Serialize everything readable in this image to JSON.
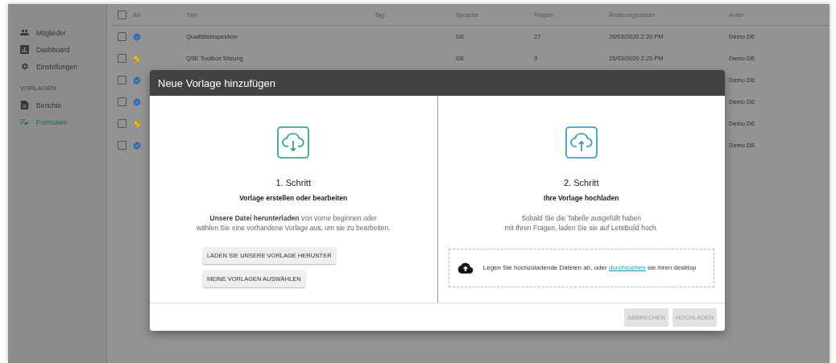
{
  "sidebar": {
    "items": [
      {
        "kind": "people",
        "label": "Mitglieder",
        "selected": false
      },
      {
        "kind": "chart",
        "label": "Dashboard",
        "selected": false
      },
      {
        "kind": "gear",
        "label": "Einstellungen",
        "selected": false
      }
    ],
    "section": {
      "title": "VORLAGEN",
      "items": [
        {
          "kind": "document",
          "label": "Berichte",
          "selected": false
        },
        {
          "kind": "checklist",
          "label": "Formulare",
          "selected": true
        }
      ]
    }
  },
  "table": {
    "select_all_checked": false,
    "columns": [
      "Art",
      "Titel",
      "Tag",
      "Sprache",
      "Fragen",
      "Änderungsdatum",
      "Autor"
    ],
    "rows": [
      {
        "checked": false,
        "kind": "verified",
        "title": "Qualitätsinspektion",
        "language": "DE",
        "questions": "27",
        "modified": "26/03/2020 2:20 PM",
        "author": "Demo DE"
      },
      {
        "checked": false,
        "kind": "shield",
        "title": "QSE Toolbox Sitzung",
        "language": "DE",
        "questions": "9",
        "modified": "26/03/2020 2:23 PM",
        "author": "Demo DE"
      },
      {
        "checked": false,
        "kind": "verified",
        "author": "Demo DE"
      },
      {
        "checked": false,
        "kind": "verified",
        "author": "Demo DE"
      },
      {
        "checked": false,
        "kind": "shield",
        "author": "Demo DE"
      },
      {
        "checked": false,
        "kind": "verified",
        "author": "Demo DE"
      }
    ]
  },
  "dialog": {
    "title": "Neue Vorlage hinzufügen",
    "steps": [
      {
        "kind": "download",
        "heading": "1. Schritt",
        "subtitle": "Vorlage erstellen oder bearbeiten",
        "description": [
          "**Unsere Datei herunterladen** von vorne beginnen oder",
          "wählen Sie eine vorhandene Vorlage aus, um sie zu bearbeiten."
        ],
        "buttons": [
          "LADEN SIE UNSERE VORLAGE HERUNTER",
          "MEINE VORLAGEN AUSWÄHLEN"
        ]
      },
      {
        "kind": "upload",
        "heading": "2. Schritt",
        "subtitle": "Ihre Vorlage hochladen",
        "description": [
          "Sobald Sie die Tabelle ausgefüllt haben",
          "mit Ihren Fragen, laden Sie sie auf LetsBuild hoch."
        ],
        "dropzone": {
          "text_before": "Legen Sie hochzuladende Dateien ab, oder",
          "link": "durchsuchen",
          "text_after": "sie ihren desktop"
        }
      }
    ],
    "footer_buttons": [
      {
        "label": "ABBRECHEN",
        "disabled": true
      },
      {
        "label": "HOCHLADEN",
        "disabled": true
      }
    ]
  }
}
